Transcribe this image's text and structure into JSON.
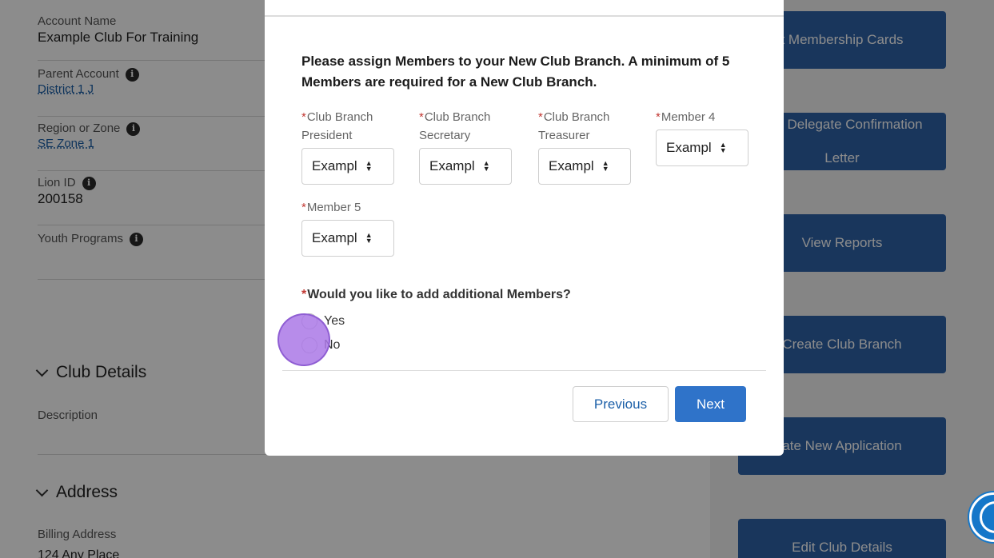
{
  "account": {
    "account_name_label": "Account Name",
    "account_name_value": "Example Club For Training",
    "parent_account_label": "Parent Account",
    "parent_account_value": "District 1 J",
    "region_label": "Region or Zone",
    "region_value": "SE Zone 1",
    "lion_id_label": "Lion ID",
    "lion_id_value": "200158",
    "youth_programs_label": "Youth Programs"
  },
  "sections": {
    "club_details": "Club Details",
    "description_label": "Description",
    "address": "Address",
    "billing_address_label": "Billing Address",
    "billing_address_value": "124 Any Place"
  },
  "actions": [
    "t Membership Cards",
    "Get Delegate Confirmation Letter",
    "View Reports",
    "Create Club Branch",
    "ate New Application",
    "Edit Club Details"
  ],
  "modal": {
    "instructions": "Please assign Members to your New Club Branch. A minimum of 5 Members are required for a New Club Branch.",
    "selects": [
      {
        "label": "Club Branch President",
        "value": "Exampl"
      },
      {
        "label": "Club Branch Secretary",
        "value": "Exampl"
      },
      {
        "label": "Club Branch Treasurer",
        "value": "Exampl"
      },
      {
        "label": "Member 4",
        "value": "Exampl"
      },
      {
        "label": "Member 5",
        "value": "Exampl"
      }
    ],
    "required_marker": "*",
    "question": "Would you like to add additional Members?",
    "options": [
      "Yes",
      "No"
    ],
    "previous_label": "Previous",
    "next_label": "Next"
  },
  "colors": {
    "primary_button": "#2f73c9",
    "action_button": "#2f63a8",
    "required": "#c23934",
    "link": "#1b5fa8"
  },
  "icons": {
    "info": "info-icon",
    "chevron": "chevron-down-icon",
    "accessibility": "accessibility-icon"
  }
}
